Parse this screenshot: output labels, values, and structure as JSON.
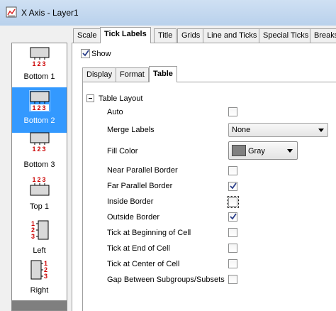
{
  "window": {
    "title": "X Axis - Layer1"
  },
  "axis_list": {
    "items": [
      {
        "label": "Bottom 1",
        "ticks": "123"
      },
      {
        "label": "Bottom 2",
        "ticks": "123"
      },
      {
        "label": "Bottom 3",
        "ticks": "123"
      },
      {
        "label": "Top 1",
        "ticks": "123"
      },
      {
        "label": "Left",
        "ticks": "123"
      },
      {
        "label": "Right",
        "ticks": "123"
      }
    ],
    "selected": "Bottom 2"
  },
  "tabs": [
    "Scale",
    "Tick Labels",
    "Title",
    "Grids",
    "Line and Ticks",
    "Special Ticks",
    "Breaks"
  ],
  "active_tab": "Tick Labels",
  "show": {
    "label": "Show",
    "checked": true
  },
  "subtabs": [
    "Display",
    "Format",
    "Table"
  ],
  "active_subtab": "Table",
  "table_layout": {
    "section_label": "Table Layout",
    "auto": {
      "label": "Auto",
      "checked": false
    },
    "merge_labels": {
      "label": "Merge Labels",
      "value": "None"
    },
    "fill_color": {
      "label": "Fill Color",
      "value": "Gray",
      "swatch": "#808080"
    },
    "options": [
      {
        "label": "Near Parallel Border",
        "checked": false
      },
      {
        "label": "Far Parallel Border",
        "checked": true
      },
      {
        "label": "Inside Border",
        "checked": false,
        "focused": true
      },
      {
        "label": "Outside Border",
        "checked": true
      },
      {
        "label": "Tick at Beginning of Cell",
        "checked": false
      },
      {
        "label": "Tick at End of Cell",
        "checked": false
      },
      {
        "label": "Tick at Center of Cell",
        "checked": false
      },
      {
        "label": "Gap Between Subgroups/Subsets",
        "checked": false
      }
    ]
  },
  "colors": {
    "selection": "#3399ff",
    "tick_number": "#cc0000"
  }
}
